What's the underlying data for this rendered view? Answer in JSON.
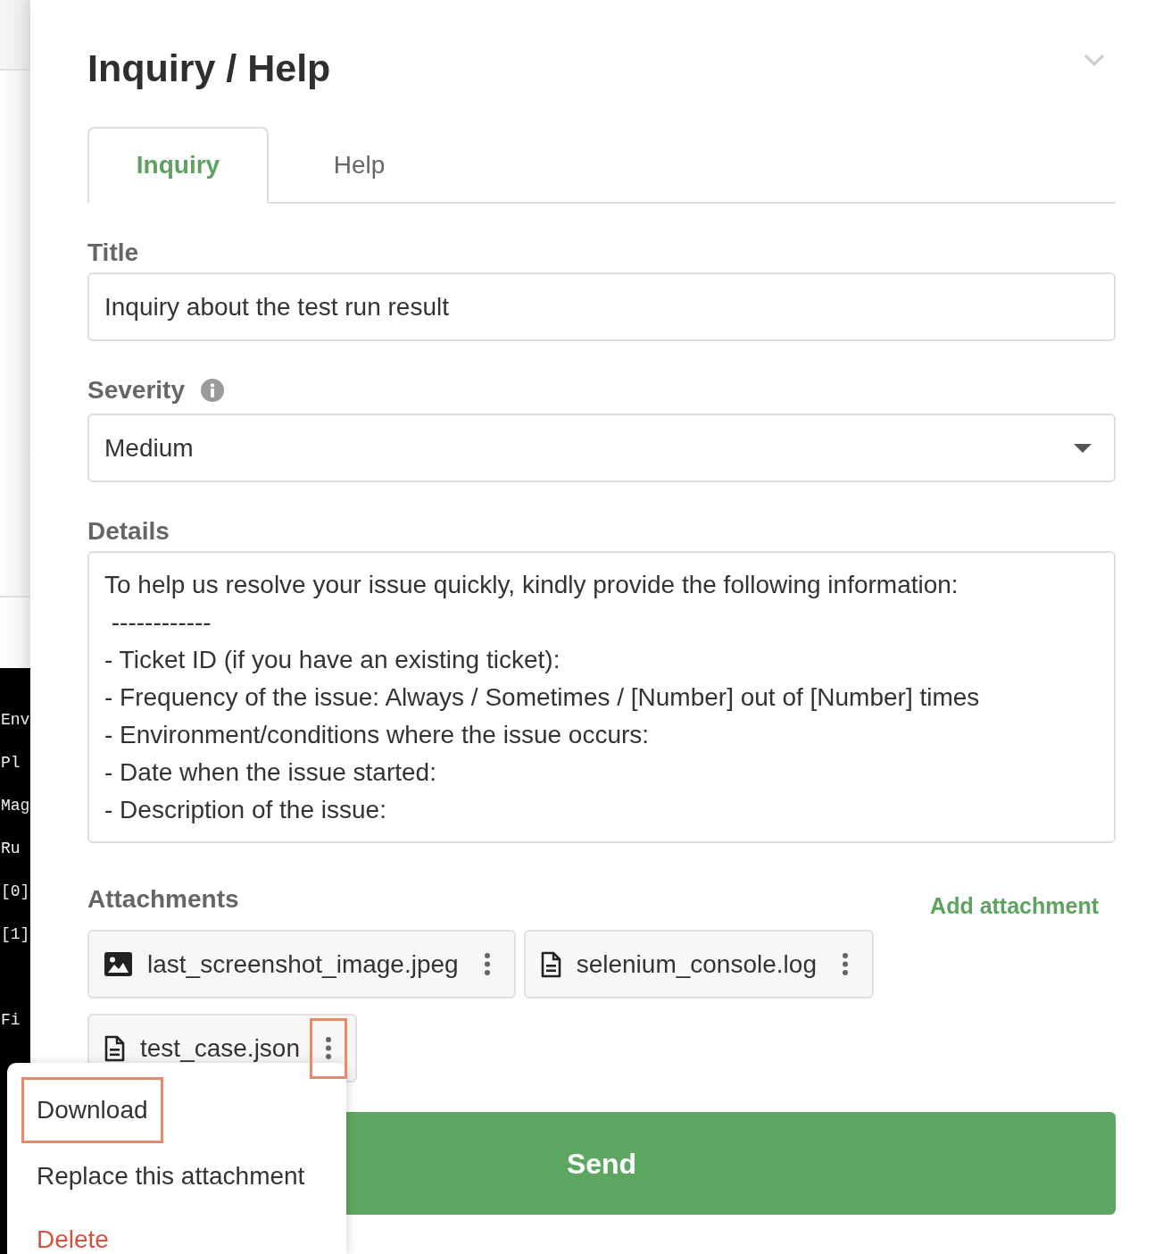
{
  "background": {
    "terminal_blocks": [
      {
        "lines": [
          "Env",
          "Pl",
          "Mag",
          "Ru",
          "[0]",
          "[1]"
        ]
      },
      {
        "lines": [
          "Fi"
        ]
      }
    ]
  },
  "panel": {
    "title": "Inquiry / Help"
  },
  "tabs": [
    {
      "label": "Inquiry",
      "selected": true
    },
    {
      "label": "Help",
      "selected": false
    }
  ],
  "form": {
    "title_field": {
      "label": "Title",
      "value": "Inquiry about the test run result"
    },
    "severity": {
      "label": "Severity",
      "value": "Medium"
    },
    "details": {
      "label": "Details",
      "value": "To help us resolve your issue quickly, kindly provide the following information:\n ------------\n- Ticket ID (if you have an existing ticket):\n- Frequency of the issue: Always / Sometimes / [Number] out of [Number] times\n- Environment/conditions where the issue occurs:\n- Date when the issue started:\n- Description of the issue:"
    }
  },
  "attachments": {
    "label": "Attachments",
    "add_link": "Add attachment",
    "files": [
      {
        "name": "last_screenshot_image.jpeg",
        "kind": "image",
        "menu_highlighted": false
      },
      {
        "name": "selenium_console.log",
        "kind": "document",
        "menu_highlighted": false
      },
      {
        "name": "test_case.json",
        "kind": "document",
        "menu_highlighted": true
      }
    ]
  },
  "send_button": {
    "label": "Send"
  },
  "file_menu": {
    "items": [
      {
        "label": "Download",
        "kind": "action",
        "highlighted": true
      },
      {
        "label": "Replace this attachment",
        "kind": "action",
        "highlighted": false
      },
      {
        "label": "Delete",
        "kind": "danger",
        "highlighted": false
      }
    ]
  }
}
